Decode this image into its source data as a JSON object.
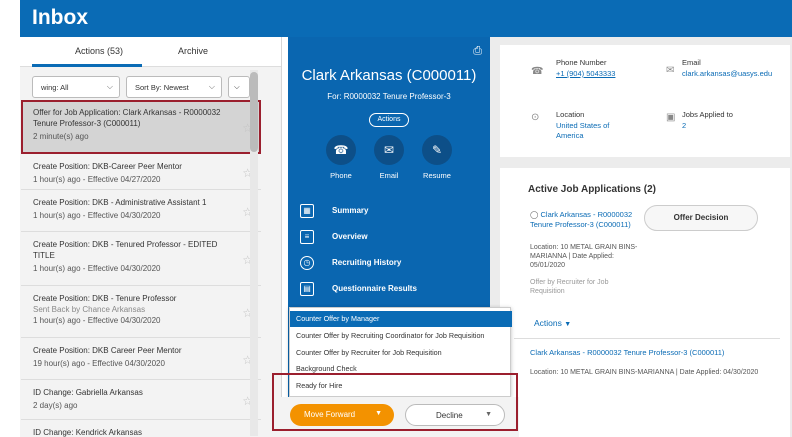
{
  "header": {
    "title": "Inbox"
  },
  "inbox": {
    "tabs": [
      {
        "label": "Actions (53)"
      },
      {
        "label": "Archive"
      }
    ],
    "filters": {
      "viewing": "wing: All",
      "sort": "Sort By: Newest"
    },
    "items": [
      {
        "title": "Offer for Job Application: Clark Arkansas - R0000032 Tenure Professor-3 (C000011)",
        "sub": "2 minute(s) ago",
        "selected": true
      },
      {
        "title": "Create Position: DKB-Career Peer Mentor",
        "sub": "1 hour(s) ago - Effective 04/27/2020"
      },
      {
        "title": "Create Position: DKB - Administrative Assistant 1",
        "sub": "1 hour(s) ago - Effective 04/30/2020"
      },
      {
        "title": "Create Position: DKB - Tenured Professor - EDITED TITLE",
        "sub": "1 hour(s) ago - Effective 04/30/2020"
      },
      {
        "title": "Create Position: DKB - Tenure Professor",
        "sub2": "Sent Back by Chance Arkansas",
        "sub": "1 hour(s) ago - Effective 04/30/2020"
      },
      {
        "title": "Create Position: DKB Career Peer Mentor",
        "sub": "19 hour(s) ago - Effective 04/30/2020"
      },
      {
        "title": "ID Change: Gabriella Arkansas",
        "sub": "2 day(s) ago"
      },
      {
        "title": "ID Change: Kendrick Arkansas",
        "sub": ""
      }
    ]
  },
  "candidate": {
    "name": "Clark Arkansas (C000011)",
    "for": "For: R0000032 Tenure Professor-3",
    "actions": "Actions",
    "quick": [
      {
        "label": "Phone",
        "icon": "phone-icon"
      },
      {
        "label": "Email",
        "icon": "email-icon"
      },
      {
        "label": "Resume",
        "icon": "paperclip-icon"
      }
    ],
    "menu": [
      {
        "label": "Summary",
        "icon": "grid-icon"
      },
      {
        "label": "Overview",
        "icon": "document-icon"
      },
      {
        "label": "Recruiting History",
        "icon": "clock-icon"
      },
      {
        "label": "Questionnaire Results",
        "icon": "list-icon"
      }
    ]
  },
  "popup": {
    "options": [
      "Counter Offer by Manager",
      "Counter Offer by Recruiting Coordinator for Job Requisition",
      "Counter Offer by Recruiter for Job Requisition",
      "Background Check",
      "Ready for Hire"
    ]
  },
  "buttons": {
    "move_forward": "Move Forward",
    "decline": "Decline"
  },
  "contact": {
    "phone_label": "Phone Number",
    "phone": "+1 (904) 5043333",
    "email_label": "Email",
    "email": "clark.arkansas@uasys.edu",
    "location_label": "Location",
    "location": "United States of America",
    "jobs_label": "Jobs Applied to",
    "jobs": "2"
  },
  "applications": {
    "title": "Active Job Applications (2)",
    "app1_link": "Clark Arkansas - R0000032 Tenure Professor-3 (C000011)",
    "app1_meta": "Location: 10 METAL GRAIN BINS-MARIANNA | Date Applied: 05/01/2020",
    "app1_sub": "Offer by Recruiter for Job Requisition",
    "offer_button": "Offer Decision",
    "actions_link": "Actions",
    "app2_link": "Clark Arkansas - R0000032 Tenure Professor-3 (C000011)",
    "app2_meta": "Location: 10 METAL GRAIN BINS-MARIANNA | Date Applied: 04/30/2020"
  },
  "colors": {
    "brand": "#0a6bb5",
    "primary_action": "#f39200",
    "highlight": "#9b1f2e"
  }
}
